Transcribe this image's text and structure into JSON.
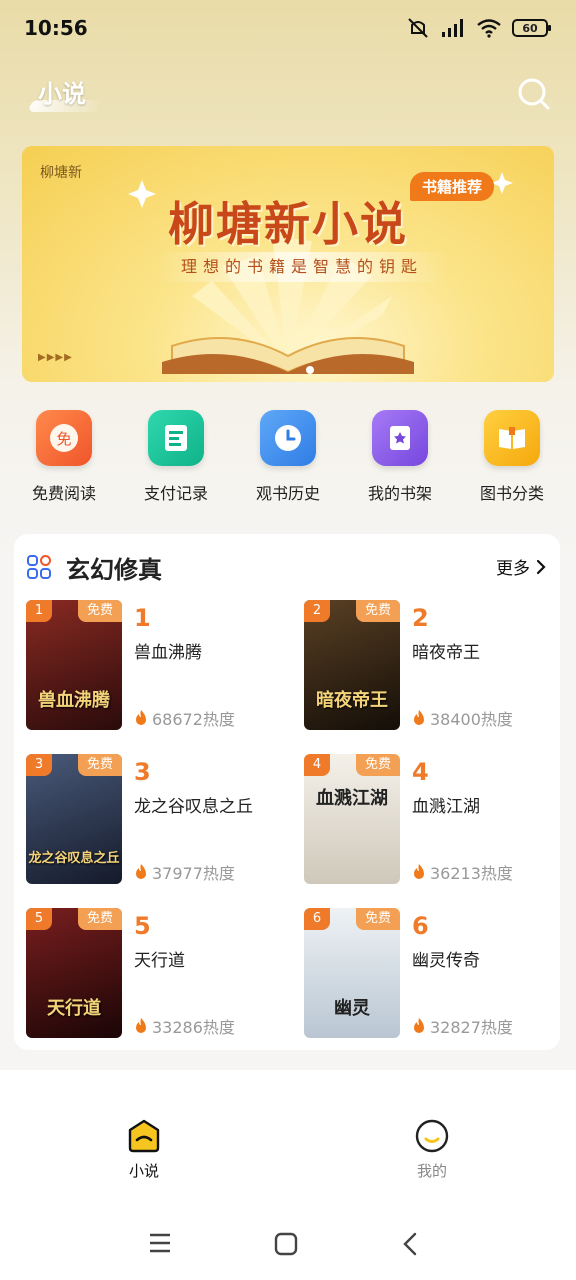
{
  "status_bar": {
    "time": "10:56",
    "battery": "60"
  },
  "header": {
    "title": "小说"
  },
  "banner": {
    "brand": "柳塘新",
    "tag": "书籍推荐",
    "title": "柳塘新小说",
    "subtitle": "理想的书籍是智慧的钥匙",
    "arrows": "▶▶▶▶"
  },
  "quick_menu": [
    {
      "label": "免费阅读",
      "icon": "free-read-icon",
      "badge": "免",
      "color": "#f46a2c"
    },
    {
      "label": "支付记录",
      "icon": "payment-record-icon",
      "color": "#18c29a"
    },
    {
      "label": "观书历史",
      "icon": "history-clock-icon",
      "color": "#3b8cf0"
    },
    {
      "label": "我的书架",
      "icon": "bookshelf-icon",
      "color": "#8a5be8"
    },
    {
      "label": "图书分类",
      "icon": "category-book-icon",
      "color": "#f5b10c"
    }
  ],
  "section": {
    "title": "玄幻修真",
    "more": "更多",
    "free_label": "免费",
    "books": [
      {
        "rank": "1",
        "name": "兽血沸腾",
        "heat": "68672热度",
        "cover_text": "兽血沸腾",
        "cover_color": "#5b1a1a"
      },
      {
        "rank": "2",
        "name": "暗夜帝王",
        "heat": "38400热度",
        "cover_text": "暗夜帝王",
        "cover_color": "#2a1d12"
      },
      {
        "rank": "3",
        "name": "龙之谷叹息之丘",
        "heat": "37977热度",
        "cover_text": "龙之谷叹息之丘",
        "cover_color": "#22304a"
      },
      {
        "rank": "4",
        "name": "血溅江湖",
        "heat": "36213热度",
        "cover_text": "血溅江湖",
        "cover_color": "#e8e4dc"
      },
      {
        "rank": "5",
        "name": "天行道",
        "heat": "33286热度",
        "cover_text": "天行道",
        "cover_color": "#3a0f10"
      },
      {
        "rank": "6",
        "name": "幽灵传奇",
        "heat": "32827热度",
        "cover_text": "幽灵",
        "cover_color": "#dfe6ec"
      }
    ]
  },
  "bottom_nav": [
    {
      "label": "小说",
      "active": true
    },
    {
      "label": "我的",
      "active": false
    }
  ]
}
